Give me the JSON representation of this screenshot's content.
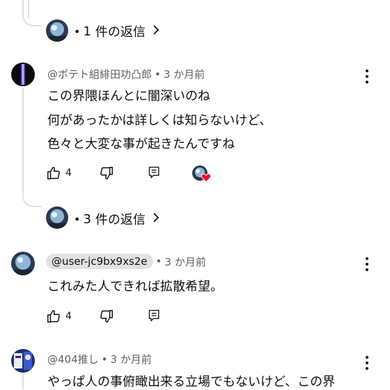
{
  "thread1": {
    "replies_count": "1",
    "replies_label": "件の返信"
  },
  "comment1": {
    "author": "@ポテト組緋田功凸郎",
    "time": "3 か月前",
    "lines": [
      "この界隈ほんとに闇深いのね",
      "何があったかは詳しくは知らないけど、",
      "色々と大変な事が起きたんですね"
    ],
    "likes": "4",
    "replies_count": "3",
    "replies_label": "件の返信"
  },
  "comment2": {
    "author": "@user-jc9bx9xs2e",
    "time": "3 か月前",
    "lines": [
      "これみた人できれば拡散希望。"
    ],
    "likes": "4"
  },
  "comment3": {
    "author": "@404推し",
    "time": "3 か月前",
    "lines": [
      "やっぱ人の事俯瞰出来る立場でもないけど、この界"
    ]
  },
  "sep": "•",
  "icons": {
    "like": "thumbs-up-icon",
    "dislike": "thumbs-down-icon",
    "reply": "reply-icon",
    "more": "more-vertical-icon",
    "chevron": "chevron-right-icon",
    "heart": "heart-icon"
  },
  "colors": {
    "heart": "#ff0033",
    "meta_text": "#606060",
    "thread_line": "#e0e0e0"
  }
}
